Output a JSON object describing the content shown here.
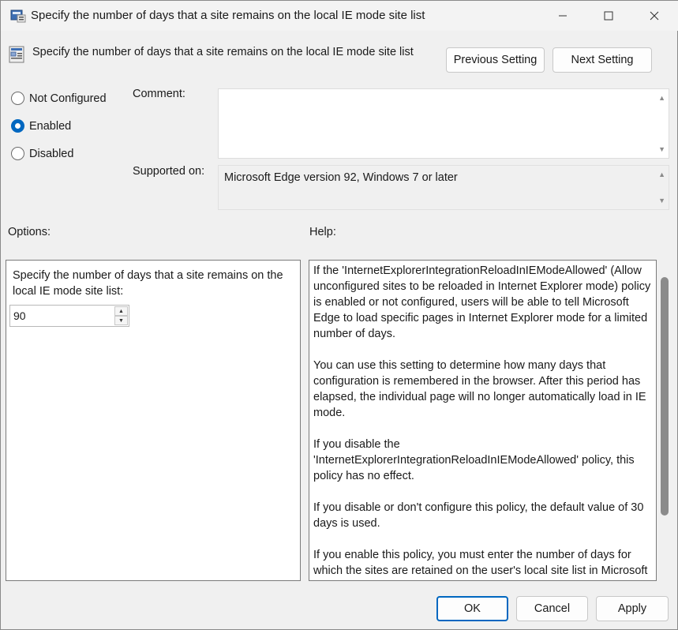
{
  "window": {
    "title": "Specify the number of days that a site remains on the local IE mode site list",
    "icon": "policy-setting-icon"
  },
  "header": {
    "text": "Specify the number of days that a site remains on the local IE mode site list",
    "icon": "policy-setting-icon",
    "previous_label": "Previous Setting",
    "next_label": "Next Setting"
  },
  "state": {
    "options": [
      {
        "label": "Not Configured",
        "checked": false
      },
      {
        "label": "Enabled",
        "checked": true
      },
      {
        "label": "Disabled",
        "checked": false
      }
    ]
  },
  "comment": {
    "label": "Comment:",
    "value": ""
  },
  "supported": {
    "label": "Supported on:",
    "value": "Microsoft Edge version 92, Windows 7 or later"
  },
  "options_section": {
    "label": "Options:",
    "field_label": "Specify the number of days that a site remains on the local IE mode site list:",
    "value": "90"
  },
  "help_section": {
    "label": "Help:",
    "paragraphs": [
      "If the 'InternetExplorerIntegrationReloadInIEModeAllowed' (Allow unconfigured sites to be reloaded in Internet Explorer mode) policy is enabled or not configured, users will be able to tell Microsoft Edge to load specific pages in Internet Explorer mode for a limited number of days.",
      "You can use this setting to determine how many days that configuration is remembered in the browser. After this period has elapsed, the individual page will no longer automatically load in IE mode.",
      "If you disable the 'InternetExplorerIntegrationReloadInIEModeAllowed' policy, this policy has no effect.",
      "If you disable or don't configure this policy, the default value of 30 days is used.",
      "If you enable this policy, you must enter the number of days for which the sites are retained on the user's local site list in Microsoft"
    ]
  },
  "footer": {
    "ok_label": "OK",
    "cancel_label": "Cancel",
    "apply_label": "Apply"
  },
  "colors": {
    "accent": "#0067c0",
    "background": "#f0f0f0"
  }
}
